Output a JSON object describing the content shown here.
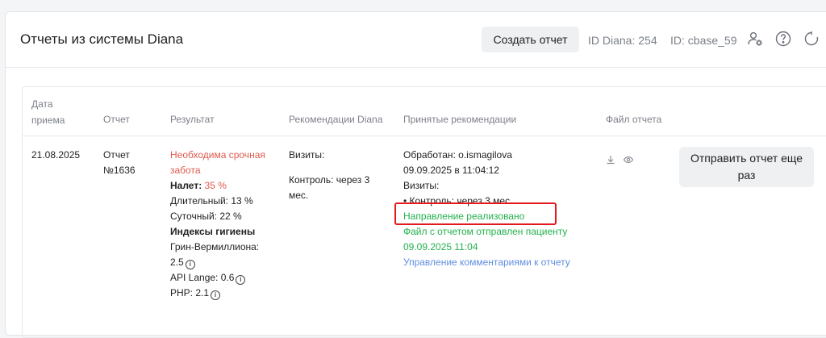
{
  "header": {
    "title": "Отчеты из системы Diana",
    "create_button": "Создать отчет",
    "id_diana": "ID Diana: 254",
    "id_cbase": "ID: cbase_59",
    "icons": [
      "user-settings-icon",
      "help-icon",
      "refresh-icon"
    ]
  },
  "table": {
    "columns": {
      "date_line1": "Дата",
      "date_line2": "приема",
      "report": "Отчет",
      "result": "Результат",
      "recommendations": "Рекомендации Diana",
      "accepted": "Принятые рекомендации",
      "file": "Файл отчета"
    },
    "row": {
      "date": "21.08.2025",
      "report_line1": "Отчет",
      "report_line2": "№1636",
      "result": {
        "urgent_line1": "Необходима срочная",
        "urgent_line2": "забота",
        "plaque_label": "Налет:",
        "plaque_value": "35 %",
        "long_term": "Длительный: 13 %",
        "daily": "Суточный: 22 %",
        "hygiene_title": "Индексы гигиены",
        "green_vermillion": "Грин-Вермиллиона:",
        "green_vermillion_value": "2.5",
        "api_lange": "API Lange: 0.6",
        "php": "PHP: 2.1"
      },
      "recommendations": {
        "visits": "Визиты:",
        "control_line1": "Контроль: через 3",
        "control_line2": "мес."
      },
      "accepted": {
        "processed": "Обработан: o.ismagilova",
        "processed_date": "09.09.2025 в 11:04:12",
        "visits": "Визиты:",
        "control": "• Контроль: через 3 мес.",
        "direction": "Направление реализовано",
        "file_sent": "Файл с отчетом отправлен пациенту",
        "file_sent_date": "09.09.2025 11:04",
        "comments_link": "Управление комментариями к отчету"
      },
      "file_icons": [
        "download-icon",
        "eye-icon"
      ],
      "resend_button": "Отправить отчет еще раз"
    }
  },
  "colors": {
    "danger": "#e05a4e",
    "success": "#22b14c",
    "link": "#5f8ee0",
    "highlight": "#e3191e"
  }
}
